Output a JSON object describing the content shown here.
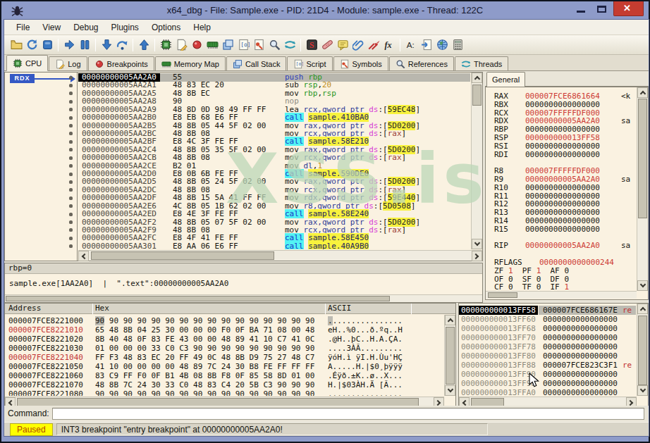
{
  "colors": {
    "titlebar": "#8e9bc9",
    "close_button": "#c53c30",
    "panel_bg": "#faf2e1",
    "selection_black": "#000000",
    "selection_gray": "#b9b7ae",
    "call_bg": "#52f3f3",
    "label_bg": "#f8f23e",
    "register_changed": "#cd3a34",
    "paused_badge_bg": "#ffff00",
    "paused_text": "#b34700",
    "watermark_green": "#48a546"
  },
  "window": {
    "title": "x64_dbg - File: Sample.exe - PID: 21D4 - Module: sample.exe - Thread: 122C",
    "close_glyph": "✕"
  },
  "menu": {
    "items": [
      "File",
      "View",
      "Debug",
      "Plugins",
      "Options",
      "Help"
    ]
  },
  "toolbar": {
    "groups": [
      [
        "open-folder",
        "restart",
        "stop"
      ],
      [
        "run",
        "pause"
      ],
      [
        "step-into",
        "step-over"
      ],
      [
        "step-out"
      ],
      [
        "cpu",
        "log",
        "breakpoint",
        "memory-map",
        "call-stack",
        "script",
        "symbols",
        "references",
        "threads"
      ],
      [
        "seh-chain",
        "patch",
        "comment",
        "attach",
        "detach",
        "fx"
      ],
      [
        "font",
        "goto",
        "globe",
        "calculator"
      ]
    ]
  },
  "tabs": [
    {
      "label": "CPU",
      "icon": "cpu",
      "active": true
    },
    {
      "label": "Log",
      "icon": "log",
      "active": false
    },
    {
      "label": "Breakpoints",
      "icon": "breakpoint",
      "active": false
    },
    {
      "label": "Memory Map",
      "icon": "memory-map",
      "active": false
    },
    {
      "label": "Call Stack",
      "icon": "call-stack",
      "active": false
    },
    {
      "label": "Script",
      "icon": "script",
      "active": false
    },
    {
      "label": "Symbols",
      "icon": "symbols",
      "active": false
    },
    {
      "label": "References",
      "icon": "references",
      "active": false
    },
    {
      "label": "Threads",
      "icon": "threads",
      "active": false
    }
  ],
  "disasm": {
    "jump_label": "RDX",
    "watermark": "XSS.is",
    "rows": [
      {
        "a": "00000000005AA2A0",
        "b": "55",
        "sel": true,
        "s": [
          [
            "push ",
            "b"
          ],
          [
            "rbp",
            "g"
          ]
        ]
      },
      {
        "a": "00000000005AA2A1",
        "b": "48 83 EC 20",
        "s": [
          [
            "sub ",
            "k"
          ],
          [
            "rsp",
            "g"
          ],
          [
            ",",
            "k"
          ],
          [
            "20",
            "o"
          ]
        ]
      },
      {
        "a": "00000000005AA2A5",
        "b": "48 8B EC",
        "s": [
          [
            "mov ",
            "k"
          ],
          [
            "rbp",
            "g"
          ],
          [
            ",",
            "k"
          ],
          [
            "rsp",
            "g"
          ]
        ]
      },
      {
        "a": "00000000005AA2A8",
        "b": "90",
        "s": [
          [
            "nop",
            "x"
          ]
        ]
      },
      {
        "a": "00000000005AA2A9",
        "b": "48 8D 0D 98 49 FF FF",
        "s": [
          [
            "lea ",
            "k"
          ],
          [
            "rcx,qword ptr ",
            "n"
          ],
          [
            "ds",
            "d"
          ],
          [
            ":[",
            "k"
          ],
          [
            "59EC48",
            "y"
          ],
          [
            "]",
            "k"
          ]
        ]
      },
      {
        "a": "00000000005AA2B0",
        "b": "E8 EB 68 E6 FF",
        "s": [
          [
            "call",
            "c"
          ],
          [
            " ",
            "k"
          ],
          [
            "sample.410BA0",
            "l"
          ]
        ]
      },
      {
        "a": "00000000005AA2B5",
        "b": "48 8B 05 44 5F 02 00",
        "s": [
          [
            "mov ",
            "k"
          ],
          [
            "rax,qword ptr ",
            "n"
          ],
          [
            "ds",
            "d"
          ],
          [
            ":[",
            "k"
          ],
          [
            "5D0200",
            "y"
          ],
          [
            "]",
            "k"
          ]
        ]
      },
      {
        "a": "00000000005AA2BC",
        "b": "48 8B 08",
        "s": [
          [
            "mov ",
            "k"
          ],
          [
            "rcx,qword ptr ",
            "n"
          ],
          [
            "ds",
            "d"
          ],
          [
            ":[",
            "k"
          ],
          [
            "rax",
            "m"
          ],
          [
            "]",
            "k"
          ]
        ]
      },
      {
        "a": "00000000005AA2BF",
        "b": "E8 4C 3F FE FF",
        "s": [
          [
            "call",
            "c"
          ],
          [
            " ",
            "k"
          ],
          [
            "sample.58E210",
            "l"
          ]
        ]
      },
      {
        "a": "00000000005AA2C4",
        "b": "48 8B 05 35 5F 02 00",
        "s": [
          [
            "mov ",
            "k"
          ],
          [
            "rax,qword ptr ",
            "n"
          ],
          [
            "ds",
            "d"
          ],
          [
            ":[",
            "k"
          ],
          [
            "5D0200",
            "y"
          ],
          [
            "]",
            "k"
          ]
        ]
      },
      {
        "a": "00000000005AA2CB",
        "b": "48 8B 08",
        "s": [
          [
            "mov ",
            "k"
          ],
          [
            "rcx,qword ptr ",
            "n"
          ],
          [
            "ds",
            "d"
          ],
          [
            ":[",
            "k"
          ],
          [
            "rax",
            "m"
          ],
          [
            "]",
            "k"
          ]
        ]
      },
      {
        "a": "00000000005AA2CE",
        "b": "B2 01",
        "s": [
          [
            "mov ",
            "k"
          ],
          [
            "dl",
            "n"
          ],
          [
            ",",
            "k"
          ],
          [
            "1",
            "o"
          ]
        ]
      },
      {
        "a": "00000000005AA2D0",
        "b": "E8 0B 6B FE FF",
        "s": [
          [
            "call",
            "c"
          ],
          [
            " ",
            "k"
          ],
          [
            "sample.590DE0",
            "l"
          ]
        ]
      },
      {
        "a": "00000000005AA2D5",
        "b": "48 8B 05 24 5F 02 00",
        "s": [
          [
            "mov ",
            "k"
          ],
          [
            "rax,qword ptr ",
            "n"
          ],
          [
            "ds",
            "d"
          ],
          [
            ":[",
            "k"
          ],
          [
            "5D0200",
            "y"
          ],
          [
            "]",
            "k"
          ]
        ]
      },
      {
        "a": "00000000005AA2DC",
        "b": "48 8B 08",
        "s": [
          [
            "mov ",
            "k"
          ],
          [
            "rcx,qword ptr ",
            "n"
          ],
          [
            "ds",
            "d"
          ],
          [
            ":[",
            "k"
          ],
          [
            "rax",
            "m"
          ],
          [
            "]",
            "k"
          ]
        ]
      },
      {
        "a": "00000000005AA2DF",
        "b": "48 8B 15 5A 41 FF FF",
        "s": [
          [
            "mov ",
            "k"
          ],
          [
            "rdx,qword ptr ",
            "n"
          ],
          [
            "ds",
            "d"
          ],
          [
            ":[",
            "k"
          ],
          [
            "59E440",
            "y"
          ],
          [
            "]",
            "k"
          ]
        ]
      },
      {
        "a": "00000000005AA2E6",
        "b": "4C 8B 05 1B 62 02 00",
        "s": [
          [
            "mov ",
            "k"
          ],
          [
            "r8,qword ptr ",
            "n"
          ],
          [
            "ds",
            "d"
          ],
          [
            ":[",
            "k"
          ],
          [
            "5D0508",
            "y"
          ],
          [
            "]",
            "k"
          ]
        ]
      },
      {
        "a": "00000000005AA2ED",
        "b": "E8 4E 3F FE FF",
        "s": [
          [
            "call",
            "c"
          ],
          [
            " ",
            "k"
          ],
          [
            "sample.58E240",
            "l"
          ]
        ]
      },
      {
        "a": "00000000005AA2F2",
        "b": "48 8B 05 07 5F 02 00",
        "s": [
          [
            "mov ",
            "k"
          ],
          [
            "rax,qword ptr ",
            "n"
          ],
          [
            "ds",
            "d"
          ],
          [
            ":[",
            "k"
          ],
          [
            "5D0200",
            "y"
          ],
          [
            "]",
            "k"
          ]
        ]
      },
      {
        "a": "00000000005AA2F9",
        "b": "48 8B 08",
        "s": [
          [
            "mov ",
            "k"
          ],
          [
            "rcx,qword ptr ",
            "n"
          ],
          [
            "ds",
            "d"
          ],
          [
            ":[",
            "k"
          ],
          [
            "rax",
            "m"
          ],
          [
            "]",
            "k"
          ]
        ]
      },
      {
        "a": "00000000005AA2FC",
        "b": "E8 4F 41 FE FF",
        "s": [
          [
            "call",
            "c"
          ],
          [
            " ",
            "k"
          ],
          [
            "sample.58E450",
            "l"
          ]
        ]
      },
      {
        "a": "00000000005AA301",
        "b": "E8 AA 06 E6 FF",
        "s": [
          [
            "call",
            "c"
          ],
          [
            " ",
            "k"
          ],
          [
            "sample.40A9B0",
            "l"
          ]
        ]
      }
    ]
  },
  "info": {
    "line1": "rbp=0",
    "line2": "sample.exe[1AA2A0]  |  \".text\":00000000005AA2A0"
  },
  "registers": {
    "tab": "General",
    "rows": [
      {
        "n": "RAX",
        "v": "000007FCE6861664",
        "red": true,
        "ann": "<k"
      },
      {
        "n": "RBX",
        "v": "0000000000000000",
        "red": false,
        "ann": ""
      },
      {
        "n": "RCX",
        "v": "000007FFFFFDF000",
        "red": true,
        "ann": ""
      },
      {
        "n": "RDX",
        "v": "00000000005AA2A0",
        "red": true,
        "ann": "sa"
      },
      {
        "n": "RBP",
        "v": "0000000000000000",
        "red": false,
        "ann": ""
      },
      {
        "n": "RSP",
        "v": "000000000013FF58",
        "red": true,
        "ann": ""
      },
      {
        "n": "RSI",
        "v": "0000000000000000",
        "red": false,
        "ann": ""
      },
      {
        "n": "RDI",
        "v": "0000000000000000",
        "red": false,
        "ann": ""
      },
      null,
      {
        "n": "R8",
        "v": "000007FFFFFDF000",
        "red": true,
        "ann": ""
      },
      {
        "n": "R9",
        "v": "00000000005AA2A0",
        "red": true,
        "ann": "sa"
      },
      {
        "n": "R10",
        "v": "0000000000000000",
        "red": false,
        "ann": ""
      },
      {
        "n": "R11",
        "v": "0000000000000000",
        "red": false,
        "ann": ""
      },
      {
        "n": "R12",
        "v": "0000000000000000",
        "red": false,
        "ann": ""
      },
      {
        "n": "R13",
        "v": "0000000000000000",
        "red": false,
        "ann": ""
      },
      {
        "n": "R14",
        "v": "0000000000000000",
        "red": false,
        "ann": ""
      },
      {
        "n": "R15",
        "v": "0000000000000000",
        "red": false,
        "ann": ""
      },
      null,
      {
        "n": "RIP",
        "v": "00000000005AA2A0",
        "red": true,
        "ann": "sa"
      }
    ],
    "rflags": {
      "label": "RFLAGS",
      "value": "0000000000000244"
    },
    "flags": [
      [
        [
          "ZF",
          "1",
          true
        ],
        [
          "PF",
          "1",
          true
        ],
        [
          "AF",
          "0",
          false
        ]
      ],
      [
        [
          "OF",
          "0",
          false
        ],
        [
          "SF",
          "0",
          false
        ],
        [
          "DF",
          "0",
          false
        ]
      ],
      [
        [
          "CF",
          "0",
          false
        ],
        [
          "TF",
          "0",
          false
        ],
        [
          "IF",
          "1",
          true
        ]
      ]
    ]
  },
  "dump": {
    "headers": [
      "Address",
      "Hex",
      "ASCII"
    ],
    "rows": [
      {
        "a": "000007FCE8221000",
        "red": false,
        "selFirst": true,
        "h": "90 90 90 90 90 90 90 90 90 90 90 90 90 90 90 90",
        "t": "................"
      },
      {
        "a": "000007FCE8221010",
        "red": true,
        "selFirst": false,
        "h": "65 48 8B 04 25 30 00 00 00 F0 0F BA 71 08 00 48",
        "t": "eH..%0...ð.ºq..H"
      },
      {
        "a": "000007FCE8221020",
        "red": false,
        "selFirst": false,
        "h": "8B 40 48 0F 83 FE 43 00 00 48 89 41 10 C7 41 0C",
        "t": ".@H..þC..H.A.ÇA."
      },
      {
        "a": "000007FCE8221030",
        "red": false,
        "selFirst": false,
        "h": "01 00 00 00 33 C0 C3 90 90 90 90 90 90 90 90 90",
        "t": "....3ÀÃ........."
      },
      {
        "a": "000007FCE8221040",
        "red": true,
        "selFirst": false,
        "h": "FF F3 48 83 EC 20 FF 49 0C 48 8B D9 75 27 48 C7",
        "t": "ÿóH.ì ÿI.H.Ùu'HÇ"
      },
      {
        "a": "000007FCE8221050",
        "red": false,
        "selFirst": false,
        "h": "41 10 00 00 00 00 48 89 7C 24 30 B8 FE FF FF FF",
        "t": "A.....H.|$0¸þÿÿÿ"
      },
      {
        "a": "000007FCE8221060",
        "red": false,
        "selFirst": false,
        "h": "83 C9 FF F0 0F B1 4B 08 8B F8 0F 85 58 8D 01 00",
        "t": ".Éÿð.±K..ø..X..."
      },
      {
        "a": "000007FCE8221070",
        "red": false,
        "selFirst": false,
        "h": "48 8B 7C 24 30 33 C0 48 83 C4 20 5B C3 90 90 90",
        "t": "H.|$03ÀH.Ä [Ã..."
      },
      {
        "a": "000007FCE8221080",
        "red": false,
        "selFirst": false,
        "h": "90 90 90 90 90 90 90 90 90 90 90 90 90 90 90 90",
        "t": "................"
      }
    ]
  },
  "stack": {
    "rows": [
      {
        "a": "000000000013FF58",
        "v": "000007FCE686167E",
        "ann": "re",
        "sel": true
      },
      {
        "a": "000000000013FF60",
        "v": "0000000000000000",
        "ann": "",
        "sel": false
      },
      {
        "a": "000000000013FF68",
        "v": "0000000000000000",
        "ann": "",
        "sel": false
      },
      {
        "a": "000000000013FF70",
        "v": "0000000000000000",
        "ann": "",
        "sel": false
      },
      {
        "a": "000000000013FF78",
        "v": "0000000000000000",
        "ann": "",
        "sel": false
      },
      {
        "a": "000000000013FF80",
        "v": "0000000000000000",
        "ann": "",
        "sel": false
      },
      {
        "a": "000000000013FF88",
        "v": "000007FCE823C3F1",
        "ann": "re",
        "sel": false
      },
      {
        "a": "000000000013FF90",
        "v": "0000000000000000",
        "ann": "",
        "sel": false
      },
      {
        "a": "000000000013FF98",
        "v": "0000000000000000",
        "ann": "",
        "sel": false
      },
      {
        "a": "000000000013FFA0",
        "v": "0000000000000000",
        "ann": "",
        "sel": false
      }
    ]
  },
  "command": {
    "label": "Command:",
    "value": "",
    "placeholder": ""
  },
  "status": {
    "state": "Paused",
    "message": "INT3 breakpoint \"entry breakpoint\" at 00000000005AA2A0!"
  }
}
